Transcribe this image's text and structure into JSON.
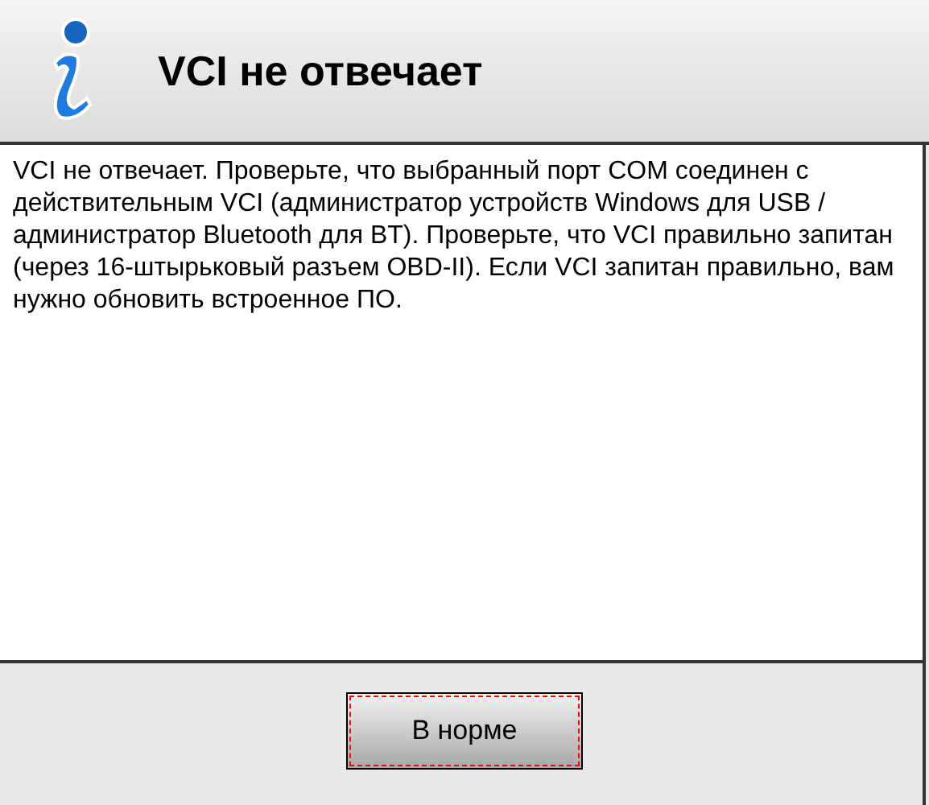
{
  "dialog": {
    "title": "VCI не отвечает",
    "message": "VCI не отвечает. Проверьте, что выбранный порт COM соединен с действительным VCI (администратор устройств Windows для USB / администратор Bluetooth для BT). Проверьте, что VCI правильно запитан (через 16-штырьковый разъем OBD-II). Если VCI запитан правильно, вам нужно обновить встроенное ПО.",
    "button": {
      "label": "В норме",
      "focused": true
    }
  }
}
